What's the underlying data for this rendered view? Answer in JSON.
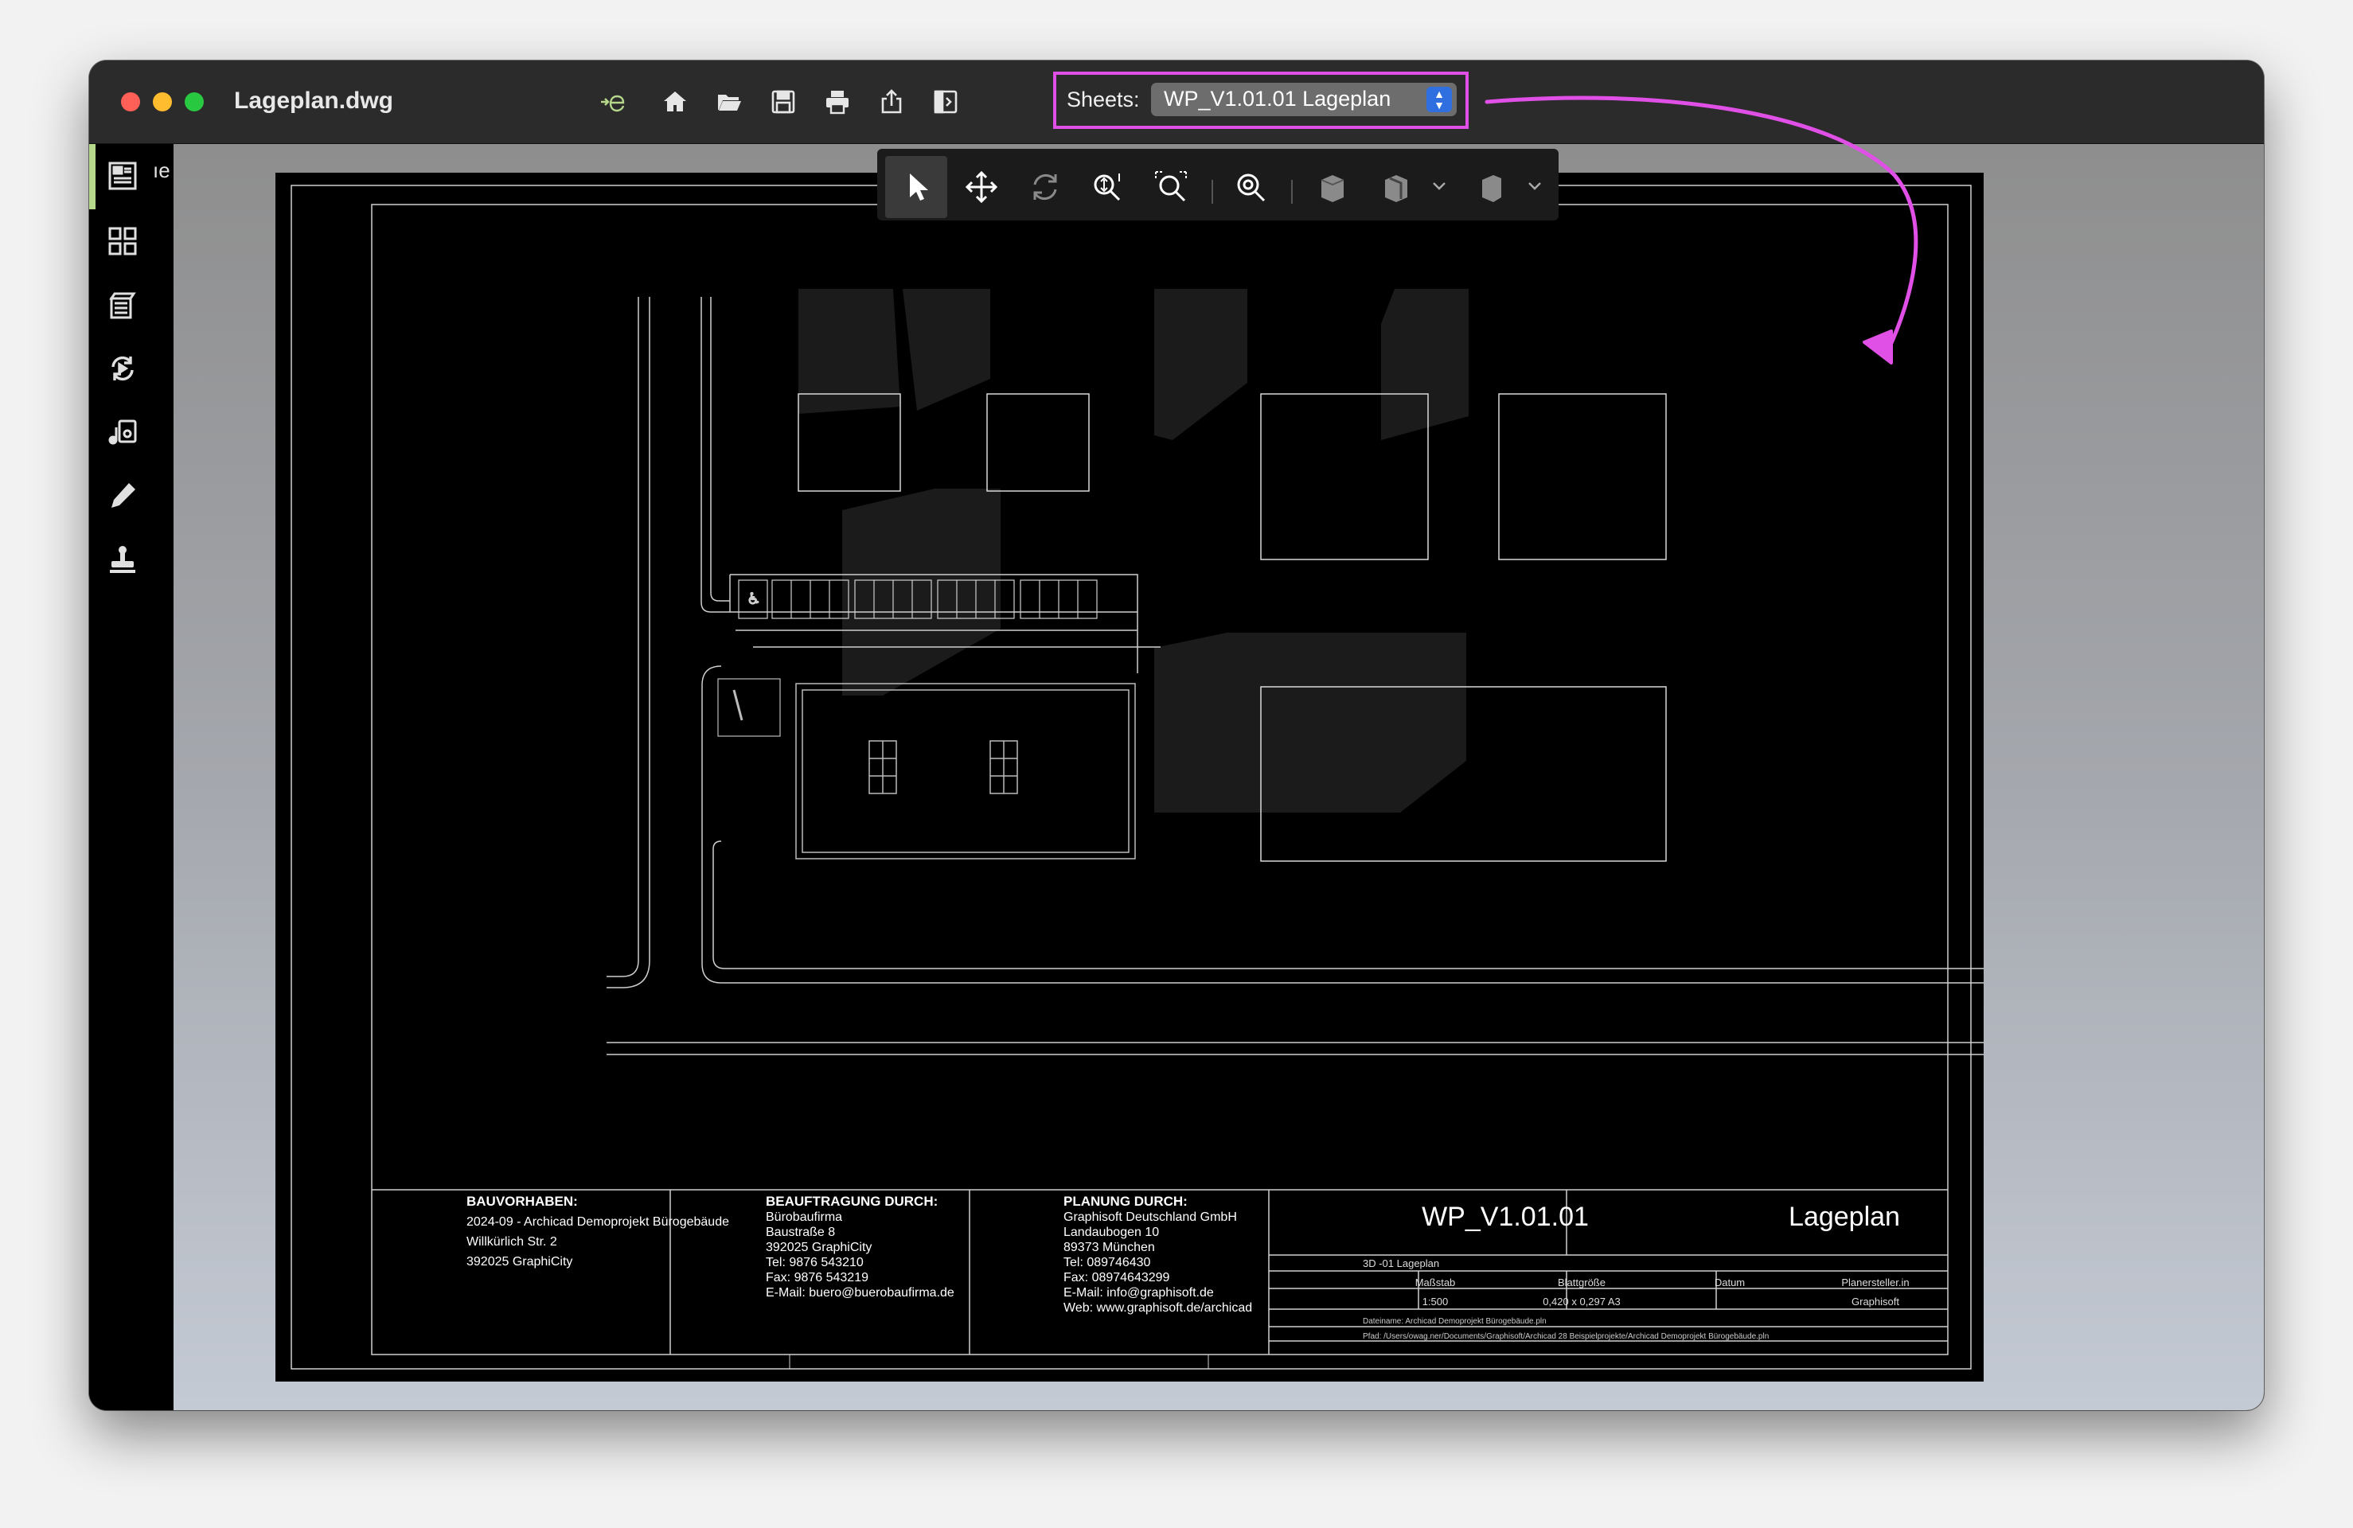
{
  "window": {
    "title": "Lageplan.dwg"
  },
  "toolbar": {
    "icons": [
      "enter-edit-icon",
      "home-icon",
      "folder-open-icon",
      "save-icon",
      "print-icon",
      "share-icon",
      "panel-toggle-icon"
    ]
  },
  "sheets": {
    "label": "Sheets:",
    "selected": "WP_V1.01.01 Lageplan"
  },
  "sidebar": {
    "truncated_label": "ıe",
    "items": [
      "sheet-icon",
      "layout-grid-icon",
      "layers-icon",
      "sync-icon",
      "music-file-icon",
      "pencil-icon",
      "stamp-icon"
    ]
  },
  "annotation": {
    "color": "#e050e6"
  },
  "title_block": {
    "bauvorhaben": {
      "heading": "BAUVORHABEN:",
      "lines": [
        "2024-09 - Archicad Demoprojekt Bürogebäude",
        "Willkürlich Str. 2",
        "392025 GraphiCity"
      ]
    },
    "beauftragung": {
      "heading": "BEAUFTRAGUNG DURCH:",
      "lines": [
        "Bürobaufirma",
        "Baustraße 8",
        "392025 GraphiCity",
        "Tel: 9876 543210",
        "Fax: 9876 543219",
        "E-Mail: buero@buerobaufirma.de"
      ]
    },
    "planung": {
      "heading": "PLANUNG DURCH:",
      "lines": [
        "Graphisoft Deutschland GmbH",
        "Landaubogen 10",
        "89373 München",
        "Tel: 089746430",
        "Fax: 08974643299",
        "E-Mail: info@graphisoft.de",
        "Web: www.graphisoft.de/archicad"
      ]
    },
    "sheet_id": "WP_V1.01.01",
    "sheet_name": "Lageplan",
    "view_label": "3D -01 Lageplan",
    "table_headers": [
      "Maßstab",
      "Blattgröße",
      "Datum",
      "Planersteller.in"
    ],
    "table_values": [
      "1:500",
      "0,420 x 0,297 A3",
      "",
      "Graphisoft"
    ],
    "dateiname": "Dateiname: Archicad Demoprojekt Bürogebäude.pln",
    "pfad": "Pfad: /Users/owag.ner/Documents/Graphisoft/Archicad 28 Beispielprojekte/Archicad Demoprojekt Bürogebäude.pln"
  }
}
